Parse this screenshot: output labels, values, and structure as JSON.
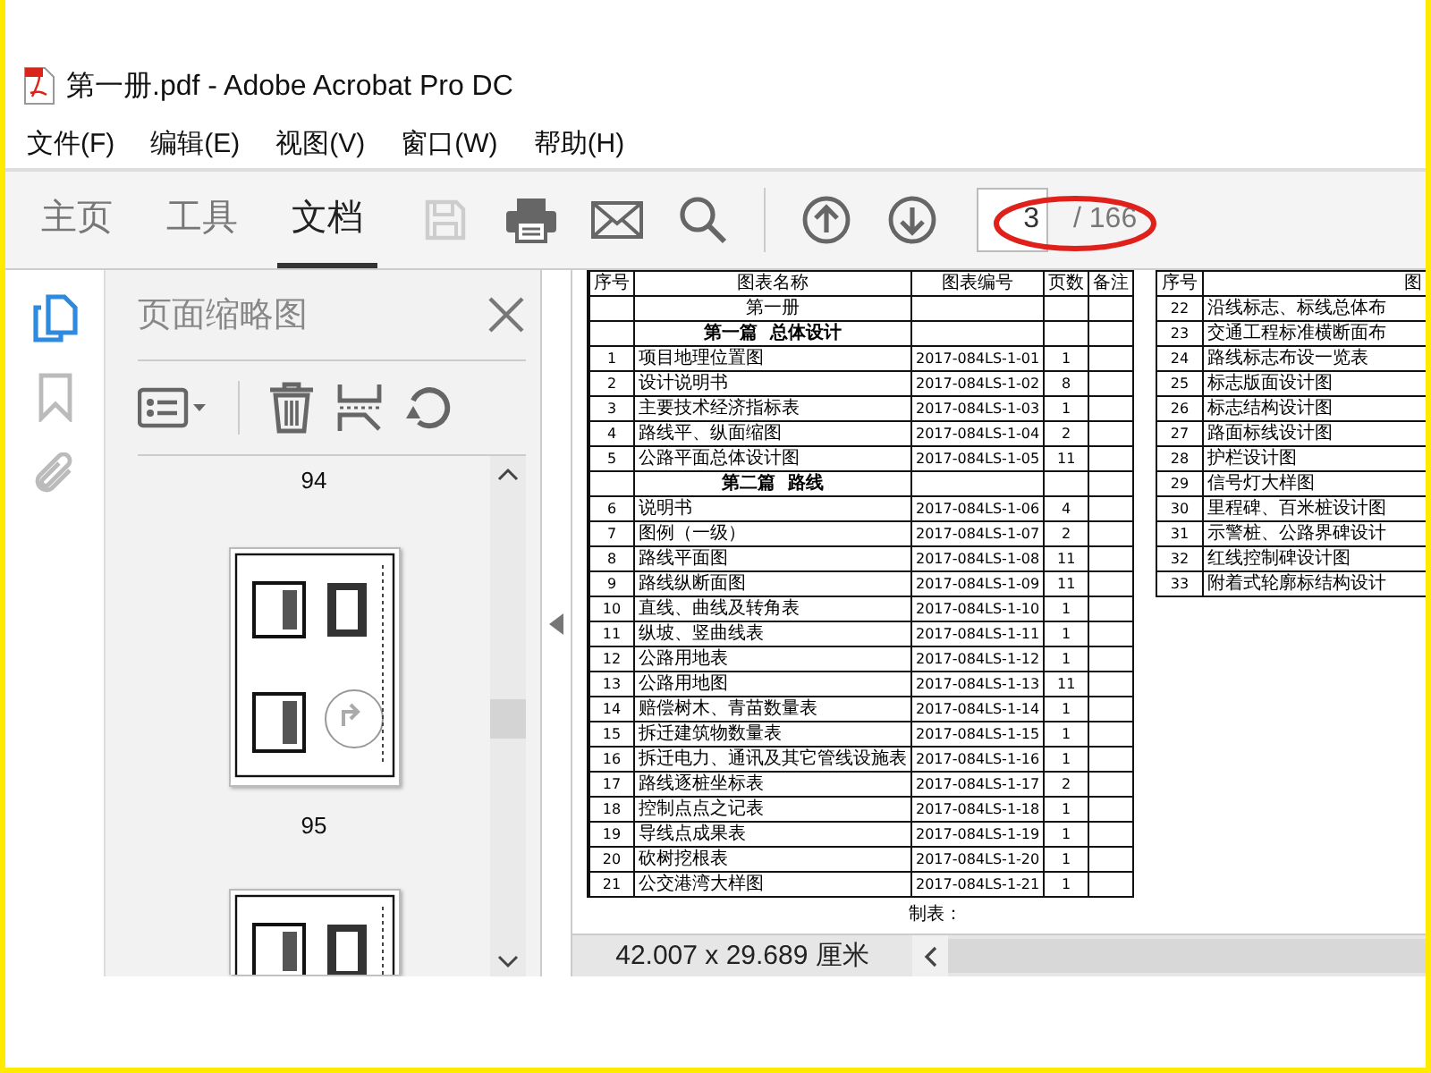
{
  "window": {
    "title": "第一册.pdf - Adobe Acrobat Pro DC"
  },
  "menu": [
    "文件(F)",
    "编辑(E)",
    "视图(V)",
    "窗口(W)",
    "帮助(H)"
  ],
  "tabs": [
    {
      "label": "主页",
      "selected": false
    },
    {
      "label": "工具",
      "selected": false
    },
    {
      "label": "文档",
      "selected": true
    }
  ],
  "tools": [
    {
      "kind": "save",
      "disabled": true
    },
    {
      "kind": "print",
      "disabled": false
    },
    {
      "kind": "mail",
      "disabled": false
    },
    {
      "kind": "search",
      "disabled": false
    },
    {
      "kind": "sep"
    },
    {
      "kind": "up",
      "disabled": false
    },
    {
      "kind": "down",
      "disabled": false
    }
  ],
  "page_nav": {
    "current": "3",
    "total": "/ 166"
  },
  "rail": [
    {
      "kind": "pages",
      "selected": true
    },
    {
      "kind": "bookmark",
      "selected": false
    },
    {
      "kind": "attachment",
      "selected": false
    }
  ],
  "side_panel": {
    "title": "页面缩略图",
    "page_labels": [
      "94",
      "95"
    ]
  },
  "document": {
    "left_table": {
      "columns": [
        "序号",
        "图表名称",
        "图表编号",
        "页数",
        "备注"
      ],
      "rows": [
        {
          "kind": "volume",
          "name": "第一册"
        },
        {
          "kind": "part",
          "name": "第一篇  总体设计"
        },
        {
          "kind": "item",
          "no": "1",
          "name": "项目地理位置图",
          "code": "2017-084LS-1-01",
          "pages": "1"
        },
        {
          "kind": "item",
          "no": "2",
          "name": "设计说明书",
          "code": "2017-084LS-1-02",
          "pages": "8"
        },
        {
          "kind": "item",
          "no": "3",
          "name": "主要技术经济指标表",
          "code": "2017-084LS-1-03",
          "pages": "1"
        },
        {
          "kind": "item",
          "no": "4",
          "name": "路线平、纵面缩图",
          "code": "2017-084LS-1-04",
          "pages": "2"
        },
        {
          "kind": "item",
          "no": "5",
          "name": "公路平面总体设计图",
          "code": "2017-084LS-1-05",
          "pages": "11"
        },
        {
          "kind": "part",
          "name": "第二篇  路线"
        },
        {
          "kind": "item",
          "no": "6",
          "name": "说明书",
          "code": "2017-084LS-1-06",
          "pages": "4"
        },
        {
          "kind": "item",
          "no": "7",
          "name": "图例（一级）",
          "code": "2017-084LS-1-07",
          "pages": "2"
        },
        {
          "kind": "item",
          "no": "8",
          "name": "路线平面图",
          "code": "2017-084LS-1-08",
          "pages": "11"
        },
        {
          "kind": "item",
          "no": "9",
          "name": "路线纵断面图",
          "code": "2017-084LS-1-09",
          "pages": "11"
        },
        {
          "kind": "item",
          "no": "10",
          "name": "直线、曲线及转角表",
          "code": "2017-084LS-1-10",
          "pages": "1"
        },
        {
          "kind": "item",
          "no": "11",
          "name": "纵坡、竖曲线表",
          "code": "2017-084LS-1-11",
          "pages": "1"
        },
        {
          "kind": "item",
          "no": "12",
          "name": "公路用地表",
          "code": "2017-084LS-1-12",
          "pages": "1"
        },
        {
          "kind": "item",
          "no": "13",
          "name": "公路用地图",
          "code": "2017-084LS-1-13",
          "pages": "11"
        },
        {
          "kind": "item",
          "no": "14",
          "name": "赔偿树木、青苗数量表",
          "code": "2017-084LS-1-14",
          "pages": "1"
        },
        {
          "kind": "item",
          "no": "15",
          "name": "拆迁建筑物数量表",
          "code": "2017-084LS-1-15",
          "pages": "1"
        },
        {
          "kind": "item",
          "no": "16",
          "name": "拆迁电力、通讯及其它管线设施表",
          "code": "2017-084LS-1-16",
          "pages": "1"
        },
        {
          "kind": "item",
          "no": "17",
          "name": "路线逐桩坐标表",
          "code": "2017-084LS-1-17",
          "pages": "2"
        },
        {
          "kind": "item",
          "no": "18",
          "name": "控制点点之记表",
          "code": "2017-084LS-1-18",
          "pages": "1"
        },
        {
          "kind": "item",
          "no": "19",
          "name": "导线点成果表",
          "code": "2017-084LS-1-19",
          "pages": "1"
        },
        {
          "kind": "item",
          "no": "20",
          "name": "砍树挖根表",
          "code": "2017-084LS-1-20",
          "pages": "1"
        },
        {
          "kind": "item",
          "no": "21",
          "name": "公交港湾大样图",
          "code": "2017-084LS-1-21",
          "pages": "1"
        }
      ]
    },
    "right_table": {
      "columns": [
        "序号",
        "图"
      ],
      "rows": [
        {
          "no": "22",
          "name": "沿线标志、标线总体布"
        },
        {
          "no": "23",
          "name": "交通工程标准横断面布"
        },
        {
          "no": "24",
          "name": "路线标志布设一览表"
        },
        {
          "no": "25",
          "name": "标志版面设计图"
        },
        {
          "no": "26",
          "name": "标志结构设计图"
        },
        {
          "no": "27",
          "name": "路面标线设计图"
        },
        {
          "no": "28",
          "name": "护栏设计图"
        },
        {
          "no": "29",
          "name": "信号灯大样图"
        },
        {
          "no": "30",
          "name": "里程碑、百米桩设计图"
        },
        {
          "no": "31",
          "name": "示警桩、公路界碑设计"
        },
        {
          "no": "32",
          "name": "红线控制碑设计图"
        },
        {
          "no": "33",
          "name": "附着式轮廓标结构设计"
        }
      ]
    },
    "footer": "制表："
  },
  "status_bar": {
    "page_size": "42.007 x 29.689 厘米"
  }
}
